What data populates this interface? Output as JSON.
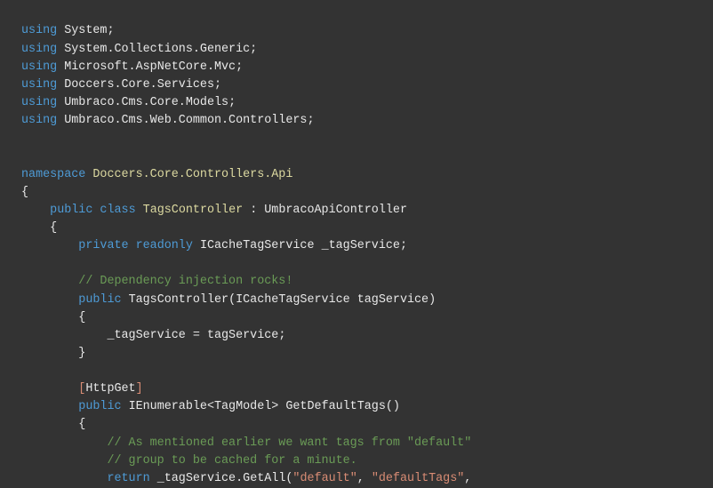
{
  "editor": {
    "language": "csharp",
    "background_color": "#333333",
    "default_text_color": "#E8E8E8",
    "theme_colors": {
      "keyword": "#4E9BD6",
      "comment": "#6A9B56",
      "string": "#D98C74",
      "type_name": "#DCD9A0",
      "plain": "#E8E8E8"
    },
    "lines": [
      {
        "number": 1,
        "indent": 0,
        "text": "using System;",
        "tokens": [
          {
            "t": "using",
            "c": "kw"
          },
          {
            "t": " ",
            "c": "plain"
          },
          {
            "t": "System",
            "c": "plain"
          },
          {
            "t": ";",
            "c": "punc"
          }
        ]
      },
      {
        "number": 2,
        "indent": 0,
        "text": "using System.Collections.Generic;",
        "tokens": [
          {
            "t": "using",
            "c": "kw"
          },
          {
            "t": " ",
            "c": "plain"
          },
          {
            "t": "System.Collections.Generic",
            "c": "plain"
          },
          {
            "t": ";",
            "c": "punc"
          }
        ]
      },
      {
        "number": 3,
        "indent": 0,
        "text": "using Microsoft.AspNetCore.Mvc;",
        "tokens": [
          {
            "t": "using",
            "c": "kw"
          },
          {
            "t": " ",
            "c": "plain"
          },
          {
            "t": "Microsoft.AspNetCore.Mvc",
            "c": "plain"
          },
          {
            "t": ";",
            "c": "punc"
          }
        ]
      },
      {
        "number": 4,
        "indent": 0,
        "text": "using Doccers.Core.Services;",
        "tokens": [
          {
            "t": "using",
            "c": "kw"
          },
          {
            "t": " ",
            "c": "plain"
          },
          {
            "t": "Doccers.Core.Services",
            "c": "plain"
          },
          {
            "t": ";",
            "c": "punc"
          }
        ]
      },
      {
        "number": 5,
        "indent": 0,
        "text": "using Umbraco.Cms.Core.Models;",
        "tokens": [
          {
            "t": "using",
            "c": "kw"
          },
          {
            "t": " ",
            "c": "plain"
          },
          {
            "t": "Umbraco.Cms.Core.Models",
            "c": "plain"
          },
          {
            "t": ";",
            "c": "punc"
          }
        ]
      },
      {
        "number": 6,
        "indent": 0,
        "text": "using Umbraco.Cms.Web.Common.Controllers;",
        "tokens": [
          {
            "t": "using",
            "c": "kw"
          },
          {
            "t": " ",
            "c": "plain"
          },
          {
            "t": "Umbraco.Cms.Web.Common.Controllers",
            "c": "plain"
          },
          {
            "t": ";",
            "c": "punc"
          }
        ]
      },
      {
        "number": 7,
        "indent": 0,
        "text": "",
        "tokens": []
      },
      {
        "number": 8,
        "indent": 0,
        "text": "",
        "tokens": []
      },
      {
        "number": 9,
        "indent": 0,
        "text": "namespace Doccers.Core.Controllers.Api",
        "tokens": [
          {
            "t": "namespace",
            "c": "kw"
          },
          {
            "t": " ",
            "c": "plain"
          },
          {
            "t": "Doccers.Core.Controllers.Api",
            "c": "name"
          }
        ]
      },
      {
        "number": 10,
        "indent": 0,
        "text": "{",
        "tokens": [
          {
            "t": "{",
            "c": "punc"
          }
        ]
      },
      {
        "number": 11,
        "indent": 1,
        "text": "    public class TagsController : UmbracoApiController",
        "tokens": [
          {
            "t": "    ",
            "c": "plain"
          },
          {
            "t": "public",
            "c": "kw"
          },
          {
            "t": " ",
            "c": "plain"
          },
          {
            "t": "class",
            "c": "kw"
          },
          {
            "t": " ",
            "c": "plain"
          },
          {
            "t": "TagsController",
            "c": "name"
          },
          {
            "t": " : ",
            "c": "plain"
          },
          {
            "t": "UmbracoApiController",
            "c": "plain"
          }
        ]
      },
      {
        "number": 12,
        "indent": 1,
        "text": "    {",
        "tokens": [
          {
            "t": "    ",
            "c": "plain"
          },
          {
            "t": "{",
            "c": "punc"
          }
        ]
      },
      {
        "number": 13,
        "indent": 2,
        "text": "        private readonly ICacheTagService _tagService;",
        "tokens": [
          {
            "t": "        ",
            "c": "plain"
          },
          {
            "t": "private",
            "c": "kw"
          },
          {
            "t": " ",
            "c": "plain"
          },
          {
            "t": "readonly",
            "c": "kw"
          },
          {
            "t": " ",
            "c": "plain"
          },
          {
            "t": "ICacheTagService",
            "c": "plain"
          },
          {
            "t": " ",
            "c": "plain"
          },
          {
            "t": "_tagService",
            "c": "plain"
          },
          {
            "t": ";",
            "c": "punc"
          }
        ]
      },
      {
        "number": 14,
        "indent": 0,
        "text": "",
        "tokens": []
      },
      {
        "number": 15,
        "indent": 2,
        "text": "        // Dependency injection rocks!",
        "tokens": [
          {
            "t": "        ",
            "c": "plain"
          },
          {
            "t": "// Dependency injection rocks!",
            "c": "cmt"
          }
        ]
      },
      {
        "number": 16,
        "indent": 2,
        "text": "        public TagsController(ICacheTagService tagService)",
        "tokens": [
          {
            "t": "        ",
            "c": "plain"
          },
          {
            "t": "public",
            "c": "kw"
          },
          {
            "t": " ",
            "c": "plain"
          },
          {
            "t": "TagsController",
            "c": "plain"
          },
          {
            "t": "(",
            "c": "punc"
          },
          {
            "t": "ICacheTagService",
            "c": "plain"
          },
          {
            "t": " ",
            "c": "plain"
          },
          {
            "t": "tagService",
            "c": "plain"
          },
          {
            "t": ")",
            "c": "punc"
          }
        ]
      },
      {
        "number": 17,
        "indent": 2,
        "text": "        {",
        "tokens": [
          {
            "t": "        ",
            "c": "plain"
          },
          {
            "t": "{",
            "c": "punc"
          }
        ]
      },
      {
        "number": 18,
        "indent": 3,
        "text": "            _tagService = tagService;",
        "tokens": [
          {
            "t": "            ",
            "c": "plain"
          },
          {
            "t": "_tagService",
            "c": "plain"
          },
          {
            "t": " = ",
            "c": "plain"
          },
          {
            "t": "tagService",
            "c": "plain"
          },
          {
            "t": ";",
            "c": "punc"
          }
        ]
      },
      {
        "number": 19,
        "indent": 2,
        "text": "        }",
        "tokens": [
          {
            "t": "        ",
            "c": "plain"
          },
          {
            "t": "}",
            "c": "punc"
          }
        ]
      },
      {
        "number": 20,
        "indent": 0,
        "text": "",
        "tokens": []
      },
      {
        "number": 21,
        "indent": 2,
        "text": "        [HttpGet]",
        "tokens": [
          {
            "t": "        ",
            "c": "plain"
          },
          {
            "t": "[",
            "c": "attrb"
          },
          {
            "t": "HttpGet",
            "c": "plain"
          },
          {
            "t": "]",
            "c": "attrb"
          }
        ]
      },
      {
        "number": 22,
        "indent": 2,
        "text": "        public IEnumerable<TagModel> GetDefaultTags()",
        "tokens": [
          {
            "t": "        ",
            "c": "plain"
          },
          {
            "t": "public",
            "c": "kw"
          },
          {
            "t": " ",
            "c": "plain"
          },
          {
            "t": "IEnumerable<TagModel>",
            "c": "plain"
          },
          {
            "t": " ",
            "c": "plain"
          },
          {
            "t": "GetDefaultTags",
            "c": "plain"
          },
          {
            "t": "()",
            "c": "punc"
          }
        ]
      },
      {
        "number": 23,
        "indent": 2,
        "text": "        {",
        "tokens": [
          {
            "t": "        ",
            "c": "plain"
          },
          {
            "t": "{",
            "c": "punc"
          }
        ]
      },
      {
        "number": 24,
        "indent": 3,
        "text": "            // As mentioned earlier we want tags from \"default\"",
        "tokens": [
          {
            "t": "            ",
            "c": "plain"
          },
          {
            "t": "// As mentioned earlier we want tags from \"default\"",
            "c": "cmt"
          }
        ]
      },
      {
        "number": 25,
        "indent": 3,
        "text": "            // group to be cached for a minute.",
        "tokens": [
          {
            "t": "            ",
            "c": "plain"
          },
          {
            "t": "// group to be cached for a minute.",
            "c": "cmt"
          }
        ]
      },
      {
        "number": 26,
        "indent": 3,
        "text": "            return _tagService.GetAll(\"default\", \"defaultTags\",",
        "tokens": [
          {
            "t": "            ",
            "c": "plain"
          },
          {
            "t": "return",
            "c": "kw"
          },
          {
            "t": " ",
            "c": "plain"
          },
          {
            "t": "_tagService",
            "c": "plain"
          },
          {
            "t": ".",
            "c": "punc"
          },
          {
            "t": "GetAll",
            "c": "plain"
          },
          {
            "t": "(",
            "c": "punc"
          },
          {
            "t": "\"default\"",
            "c": "str"
          },
          {
            "t": ", ",
            "c": "punc"
          },
          {
            "t": "\"defaultTags\"",
            "c": "str"
          },
          {
            "t": ",",
            "c": "punc"
          }
        ]
      }
    ]
  }
}
